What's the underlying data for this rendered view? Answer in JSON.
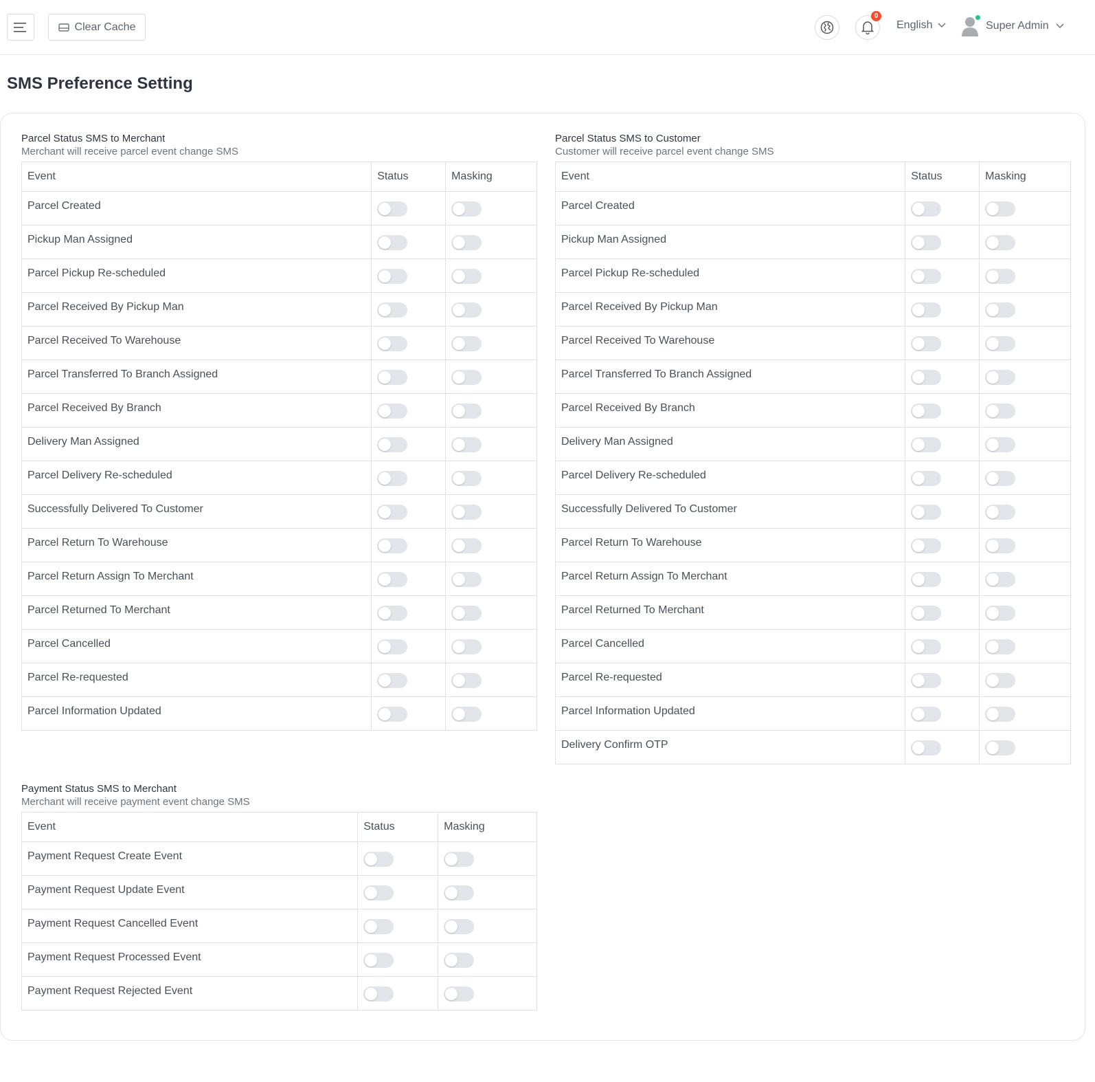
{
  "header": {
    "clear_cache_label": "Clear Cache",
    "notification_count": "0",
    "language": "English",
    "user_name": "Super Admin"
  },
  "page": {
    "title": "SMS Preference Setting"
  },
  "columns": {
    "event": "Event",
    "status": "Status",
    "masking": "Masking"
  },
  "merchant_parcel": {
    "title": "Parcel Status SMS to Merchant",
    "subtitle": "Merchant will receive parcel event change SMS",
    "events": [
      {
        "name": "Parcel Created",
        "status": false,
        "masking": false
      },
      {
        "name": "Pickup Man Assigned",
        "status": false,
        "masking": false
      },
      {
        "name": "Parcel Pickup Re-scheduled",
        "status": false,
        "masking": false
      },
      {
        "name": "Parcel Received By Pickup Man",
        "status": false,
        "masking": false
      },
      {
        "name": "Parcel Received To Warehouse",
        "status": false,
        "masking": false
      },
      {
        "name": "Parcel Transferred To Branch Assigned",
        "status": false,
        "masking": false
      },
      {
        "name": "Parcel Received By Branch",
        "status": false,
        "masking": false
      },
      {
        "name": "Delivery Man Assigned",
        "status": false,
        "masking": false
      },
      {
        "name": "Parcel Delivery Re-scheduled",
        "status": false,
        "masking": false
      },
      {
        "name": "Successfully Delivered To Customer",
        "status": false,
        "masking": false
      },
      {
        "name": "Parcel Return To Warehouse",
        "status": false,
        "masking": false
      },
      {
        "name": "Parcel Return Assign To Merchant",
        "status": false,
        "masking": false
      },
      {
        "name": "Parcel Returned To Merchant",
        "status": false,
        "masking": false
      },
      {
        "name": "Parcel Cancelled",
        "status": false,
        "masking": false
      },
      {
        "name": "Parcel Re-requested",
        "status": false,
        "masking": false
      },
      {
        "name": "Parcel Information Updated",
        "status": false,
        "masking": false
      }
    ]
  },
  "customer_parcel": {
    "title": "Parcel Status SMS to Customer",
    "subtitle": "Customer will receive parcel event change SMS",
    "events": [
      {
        "name": "Parcel Created",
        "status": false,
        "masking": false
      },
      {
        "name": "Pickup Man Assigned",
        "status": false,
        "masking": false
      },
      {
        "name": "Parcel Pickup Re-scheduled",
        "status": false,
        "masking": false
      },
      {
        "name": "Parcel Received By Pickup Man",
        "status": false,
        "masking": false
      },
      {
        "name": "Parcel Received To Warehouse",
        "status": false,
        "masking": false
      },
      {
        "name": "Parcel Transferred To Branch Assigned",
        "status": false,
        "masking": false
      },
      {
        "name": "Parcel Received By Branch",
        "status": false,
        "masking": false
      },
      {
        "name": "Delivery Man Assigned",
        "status": false,
        "masking": false
      },
      {
        "name": "Parcel Delivery Re-scheduled",
        "status": false,
        "masking": false
      },
      {
        "name": "Successfully Delivered To Customer",
        "status": false,
        "masking": false
      },
      {
        "name": "Parcel Return To Warehouse",
        "status": false,
        "masking": false
      },
      {
        "name": "Parcel Return Assign To Merchant",
        "status": false,
        "masking": false
      },
      {
        "name": "Parcel Returned To Merchant",
        "status": false,
        "masking": false
      },
      {
        "name": "Parcel Cancelled",
        "status": false,
        "masking": false
      },
      {
        "name": "Parcel Re-requested",
        "status": false,
        "masking": false
      },
      {
        "name": "Parcel Information Updated",
        "status": false,
        "masking": false
      },
      {
        "name": "Delivery Confirm OTP",
        "status": false,
        "masking": false
      }
    ]
  },
  "merchant_payment": {
    "title": "Payment Status SMS to Merchant",
    "subtitle": "Merchant will receive payment event change SMS",
    "events": [
      {
        "name": "Payment Request Create Event",
        "status": false,
        "masking": false
      },
      {
        "name": "Payment Request Update Event",
        "status": false,
        "masking": false
      },
      {
        "name": "Payment Request Cancelled Event",
        "status": false,
        "masking": false
      },
      {
        "name": "Payment Request Processed Event",
        "status": false,
        "masking": false
      },
      {
        "name": "Payment Request Rejected Event",
        "status": false,
        "masking": false
      }
    ]
  },
  "colors": {
    "toggle_off": "#e2e5ea",
    "badge": "#f1502f",
    "online": "#27c58a",
    "border": "#dee2e6"
  },
  "icons": [
    "menu-icon",
    "cache-icon",
    "globe-icon",
    "bell-icon",
    "chevron-down-icon",
    "user-avatar-icon"
  ]
}
